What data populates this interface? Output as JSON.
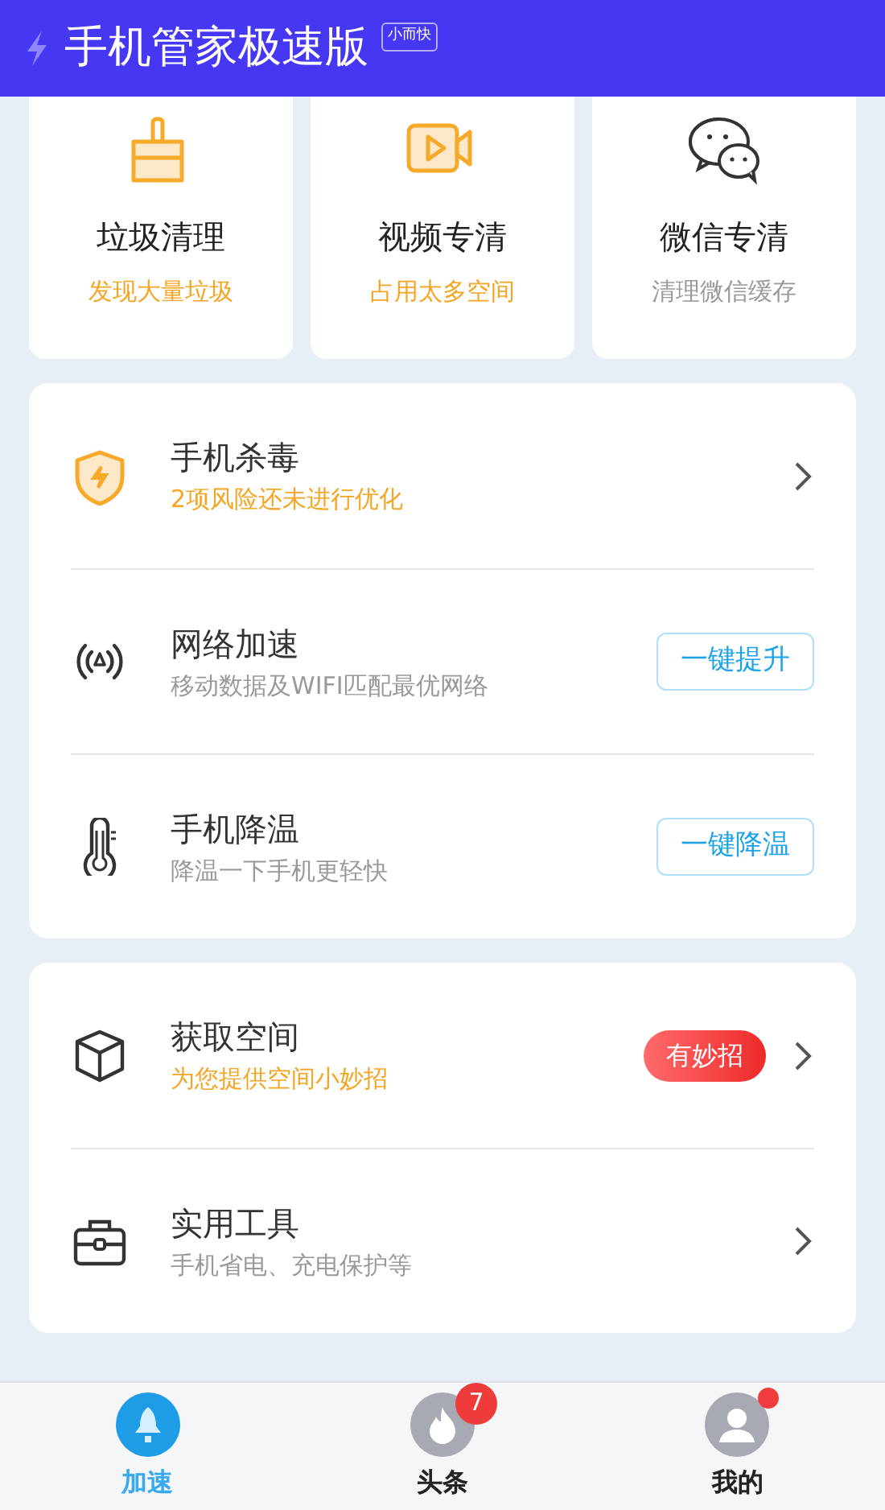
{
  "app_bar": {
    "title": "手机管家极速版",
    "badge": "小而快"
  },
  "quick_cards": [
    {
      "title": "垃圾清理",
      "subtitle": "发现大量垃圾",
      "highlight": true
    },
    {
      "title": "视频专清",
      "subtitle": "占用太多空间",
      "highlight": true
    },
    {
      "title": "微信专清",
      "subtitle": "清理微信缓存",
      "highlight": false
    }
  ],
  "sections": [
    {
      "items": [
        {
          "title": "手机杀毒",
          "subtitle": "2项风险还未进行优化",
          "highlight": true,
          "action": {
            "kind": "chevron"
          }
        },
        {
          "title": "网络加速",
          "subtitle": "移动数据及WIFI匹配最优网络",
          "highlight": false,
          "action": {
            "kind": "button",
            "label": "一键提升"
          }
        },
        {
          "title": "手机降温",
          "subtitle": "降温一下手机更轻快",
          "highlight": false,
          "action": {
            "kind": "button",
            "label": "一键降温"
          }
        }
      ]
    },
    {
      "items": [
        {
          "title": "获取空间",
          "subtitle": "为您提供空间小妙招",
          "highlight": true,
          "action": {
            "kind": "pill",
            "label": "有妙招"
          }
        },
        {
          "title": "实用工具",
          "subtitle": "手机省电、充电保护等",
          "highlight": false,
          "action": {
            "kind": "chevron"
          }
        }
      ]
    }
  ],
  "tabs": [
    {
      "label": "加速",
      "selected": true,
      "dot": false
    },
    {
      "label": "头条",
      "selected": false,
      "count": "7",
      "dot": false
    },
    {
      "label": "我的",
      "selected": false,
      "dot": true
    }
  ]
}
